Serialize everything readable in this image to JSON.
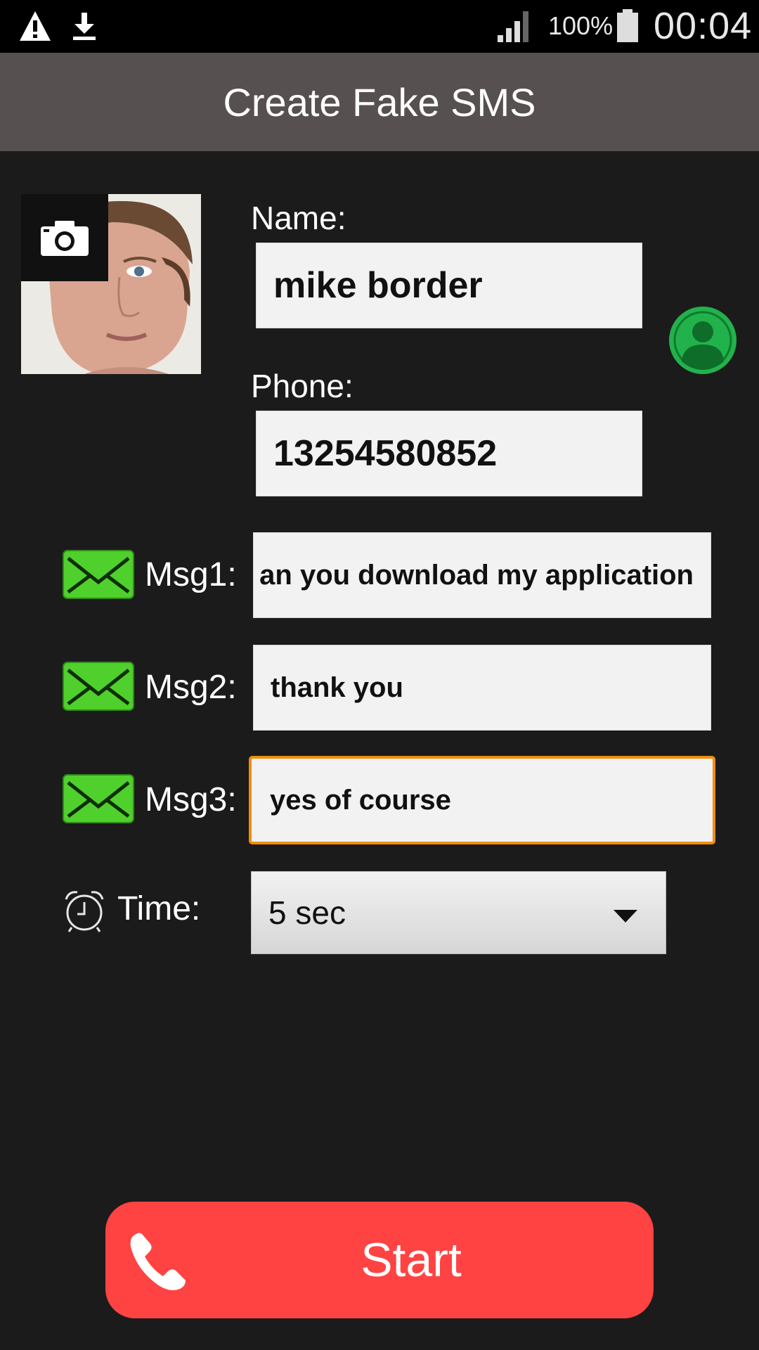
{
  "status_bar": {
    "battery": "100%",
    "time": "00:04",
    "icons": [
      "warning-icon",
      "download-icon",
      "signal-icon",
      "battery-icon"
    ]
  },
  "header": {
    "title": "Create Fake SMS"
  },
  "contact": {
    "name_label": "Name:",
    "name_value": "mike border",
    "phone_label": "Phone:",
    "phone_value": "13254580852"
  },
  "messages": [
    {
      "label": "Msg1:",
      "value": "an you download my application"
    },
    {
      "label": "Msg2:",
      "value": "thank you"
    },
    {
      "label": "Msg3:",
      "value": "yes of course"
    }
  ],
  "timer": {
    "label": "Time:",
    "selected": "5 sec"
  },
  "start_button": {
    "label": "Start"
  },
  "colors": {
    "accent_red": "#ff4343",
    "contact_green": "#22b24c",
    "message_green": "#4fd02c",
    "focus_orange": "#f28c0f",
    "title_bar": "#575050"
  }
}
